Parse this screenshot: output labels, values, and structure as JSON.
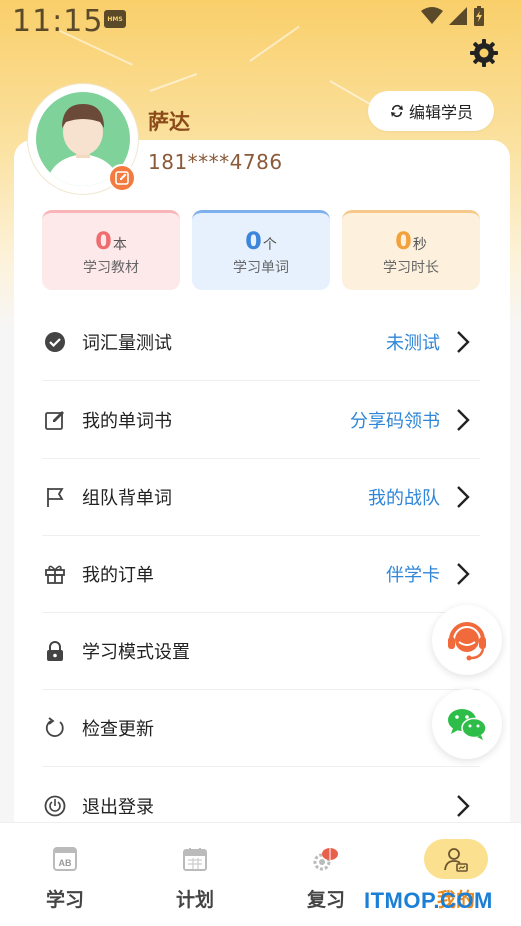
{
  "status_bar": {
    "time": "11:15",
    "hms_badge": "HMS"
  },
  "profile": {
    "username": "萨达",
    "phone": "181****4786",
    "edit_button": "编辑学员"
  },
  "stats": [
    {
      "value": "0",
      "unit": "本",
      "label": "学习教材"
    },
    {
      "value": "0",
      "unit": "个",
      "label": "学习单词"
    },
    {
      "value": "0",
      "unit": "秒",
      "label": "学习时长"
    }
  ],
  "menu": [
    {
      "icon": "check-circle-icon",
      "label": "词汇量测试",
      "value": "未测试"
    },
    {
      "icon": "edit-note-icon",
      "label": "我的单词书",
      "value": "分享码领书"
    },
    {
      "icon": "flag-icon",
      "label": "组队背单词",
      "value": "我的战队"
    },
    {
      "icon": "gift-icon",
      "label": "我的订单",
      "value": "伴学卡"
    },
    {
      "icon": "lock-icon",
      "label": "学习模式设置",
      "value": ""
    },
    {
      "icon": "refresh-icon",
      "label": "检查更新",
      "value": ""
    },
    {
      "icon": "logout-icon",
      "label": "退出登录",
      "value": ""
    }
  ],
  "tabs": [
    {
      "icon": "textbook-icon",
      "label": "学习"
    },
    {
      "icon": "calendar-icon",
      "label": "计划"
    },
    {
      "icon": "brain-gear-icon",
      "label": "复习"
    },
    {
      "icon": "profile-icon",
      "label": "我的"
    }
  ],
  "watermark": "ITMOP.COM",
  "colors": {
    "accent_blue": "#2f86d8",
    "header_yellow": "#f9cf6a",
    "active_tab": "#e78a20"
  }
}
